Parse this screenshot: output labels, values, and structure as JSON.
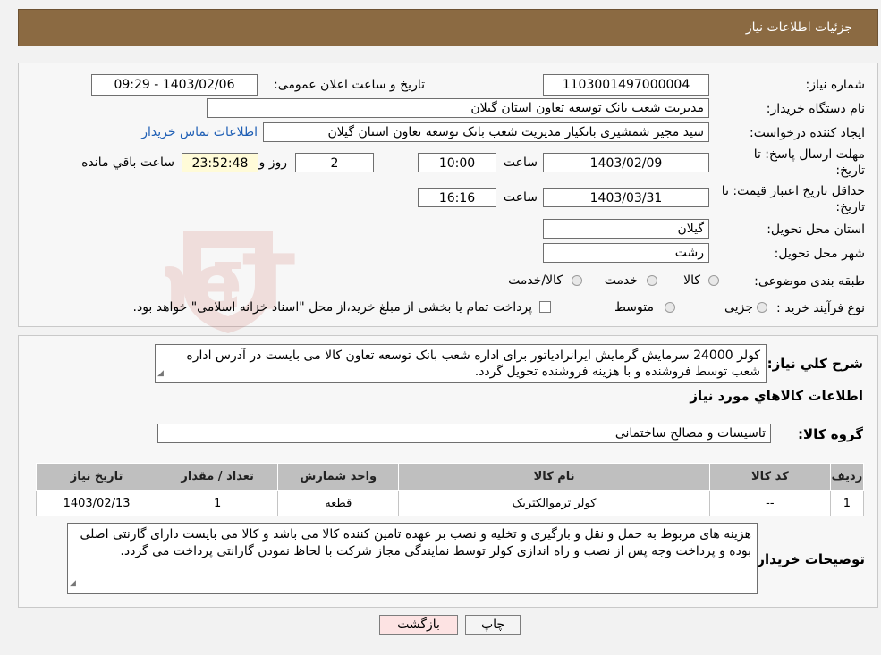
{
  "header": {
    "title": "جزئیات اطلاعات نیاز"
  },
  "fields": {
    "need_number": {
      "label": "شماره نیاز:",
      "value": "1103001497000004"
    },
    "announce_datetime": {
      "label": "تاریخ و ساعت اعلان عمومی:",
      "value": "1403/02/06 - 09:29"
    },
    "buyer_org": {
      "label": "نام دستگاه خریدار:",
      "value": "مدیریت شعب بانک توسعه تعاون استان گیلان"
    },
    "requester": {
      "label": "ایجاد کننده درخواست:",
      "value": "سید مجیر شمشیری بانکیار مدیریت شعب بانک توسعه تعاون استان گیلان",
      "link": "اطلاعات تماس خریدار"
    },
    "deadline": {
      "label_line1": "مهلت ارسال پاسخ: تا",
      "label_line2": "تاریخ:",
      "date": "1403/02/09",
      "time_label": "ساعت",
      "time": "10:00",
      "days": "2",
      "days_label": "روز و",
      "remaining": "23:52:48",
      "remaining_label": "ساعت باقي مانده"
    },
    "price_validity": {
      "label_line1": "حداقل تاریخ اعتبار قیمت: تا",
      "label_line2": "تاریخ:",
      "date": "1403/03/31",
      "time_label": "ساعت",
      "time": "16:16"
    },
    "province": {
      "label": "استان محل تحویل:",
      "value": "گیلان"
    },
    "city": {
      "label": "شهر محل تحویل:",
      "value": "رشت"
    },
    "category": {
      "label": "طبقه بندی موضوعی:",
      "options": [
        "کالا",
        "خدمت",
        "کالا/خدمت"
      ]
    },
    "purchase_type": {
      "label": "نوع فرآیند خرید :",
      "options": [
        "جزیی",
        "متوسط"
      ],
      "note": "پرداخت تمام یا بخشی از مبلغ خرید،از محل \"اسناد خزانه اسلامی\" خواهد بود."
    }
  },
  "description": {
    "label": "شرح کلي نياز:",
    "text": "کولر 24000 سرمایش گرمایش ایرانرادیاتور برای اداره شعب بانک توسعه تعاون کالا می بایست در آدرس اداره شعب توسط فروشنده و با هزینه فروشنده تحویل گردد."
  },
  "goods_section": {
    "title": "اطلاعات کالاهاي مورد نياز",
    "group_label": "گروه کالا:",
    "group_value": "تاسیسات و مصالح ساختمانی"
  },
  "table": {
    "headers": [
      "رديف",
      "کد کالا",
      "نام کالا",
      "واحد شمارش",
      "تعداد / مقدار",
      "تاریخ نیاز"
    ],
    "rows": [
      [
        "1",
        "--",
        "کولر ترموالکتریک",
        "قطعه",
        "1",
        "1403/02/13"
      ]
    ]
  },
  "buyer_notes": {
    "label": "توضیحات خریدار:",
    "text": "هزینه های مربوط  به حمل و نقل و بارگیری و تخلیه و نصب بر عهده تامین کننده کالا می باشد و کالا می بایست دارای گارنتی اصلی بوده و پرداخت وجه پس از نصب و راه اندازی کولر توسط نمایندگی مجاز شرکت با لحاظ نمودن گارانتی پرداخت می گردد."
  },
  "buttons": {
    "print": "چاپ",
    "back": "بازگشت"
  },
  "watermark": {
    "text": "AriaTender.neT"
  },
  "colors": {
    "header_bg": "#8b6a42",
    "link": "#1f5fb5",
    "back_bg": "#fde3e3",
    "watermark": "#c0392b"
  }
}
